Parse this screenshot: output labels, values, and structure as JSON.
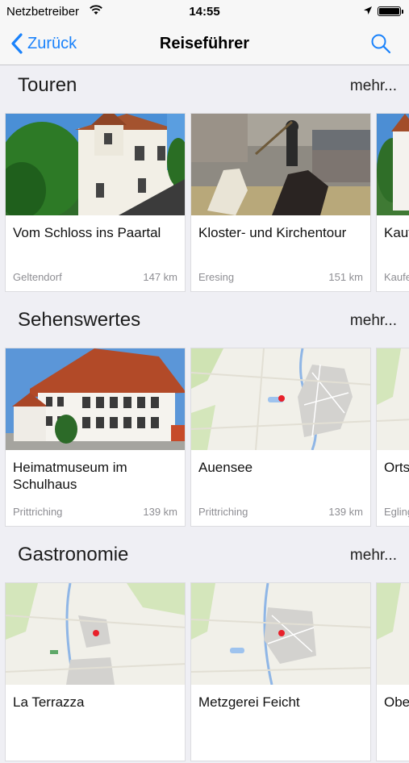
{
  "status_bar": {
    "carrier": "Netzbetreiber",
    "time": "14:55"
  },
  "nav": {
    "back_label": "Zurück",
    "title": "Reiseführer"
  },
  "sections": [
    {
      "title": "Touren",
      "more": "mehr...",
      "cards": [
        {
          "title": "Vom Schloss ins Paartal",
          "place": "Geltendorf",
          "distance": "147 km",
          "image": "castle-photo"
        },
        {
          "title": "Kloster- und Kirchentour",
          "place": "Eresing",
          "distance": "151 km",
          "image": "knight-photo"
        },
        {
          "title": "Kauf",
          "place": "Kaufe",
          "distance": "",
          "image": "building-photo"
        }
      ]
    },
    {
      "title": "Sehenswertes",
      "more": "mehr...",
      "cards": [
        {
          "title": "Heimatmuseum im Schulhaus",
          "place": "Prittriching",
          "distance": "139 km",
          "image": "museum-photo"
        },
        {
          "title": "Auensee",
          "place": "Prittriching",
          "distance": "139 km",
          "image": "map-thumbnail"
        },
        {
          "title": "Orts",
          "place": "Egling",
          "distance": "",
          "image": "map-thumbnail"
        }
      ]
    },
    {
      "title": "Gastronomie",
      "more": "mehr...",
      "cards": [
        {
          "title": "La Terrazza",
          "place": "",
          "distance": "",
          "image": "map-thumbnail"
        },
        {
          "title": "Metzgerei Feicht",
          "place": "",
          "distance": "",
          "image": "map-thumbnail"
        },
        {
          "title": "Obe",
          "place": "",
          "distance": "",
          "image": "map-thumbnail"
        }
      ]
    }
  ],
  "colors": {
    "accent": "#1a82fb",
    "background": "#efeff4",
    "map_marker": "#e8202a"
  }
}
